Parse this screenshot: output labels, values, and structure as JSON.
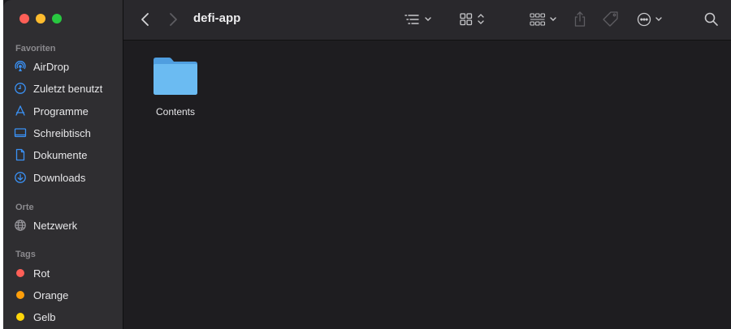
{
  "window": {
    "title": "defi-app",
    "traffic_colors": [
      "#fe5f57",
      "#febc2e",
      "#28c840"
    ]
  },
  "sidebar": {
    "favorites_title": "Favoriten",
    "favorites": [
      {
        "label": "AirDrop",
        "icon": "airdrop-icon"
      },
      {
        "label": "Zuletzt benutzt",
        "icon": "clock-icon"
      },
      {
        "label": "Programme",
        "icon": "applications-icon"
      },
      {
        "label": "Schreibtisch",
        "icon": "desktop-icon"
      },
      {
        "label": "Dokumente",
        "icon": "document-icon"
      },
      {
        "label": "Downloads",
        "icon": "download-icon"
      }
    ],
    "locations_title": "Orte",
    "locations": [
      {
        "label": "Netzwerk",
        "icon": "globe-icon"
      }
    ],
    "tags_title": "Tags",
    "tags": [
      {
        "label": "Rot",
        "color": "#ff5f57"
      },
      {
        "label": "Orange",
        "color": "#ff9f0a"
      },
      {
        "label": "Gelb",
        "color": "#ffd60a"
      }
    ]
  },
  "toolbar": {
    "icons": [
      "back-icon",
      "forward-icon",
      "list-view-icon",
      "icon-view-icon",
      "group-icon",
      "share-icon",
      "tag-icon",
      "more-icon",
      "search-icon"
    ]
  },
  "content": {
    "items": [
      {
        "name": "Contents",
        "type": "folder"
      }
    ]
  },
  "colors": {
    "accent": "#3a91f5",
    "folder": "#69b5f0"
  }
}
